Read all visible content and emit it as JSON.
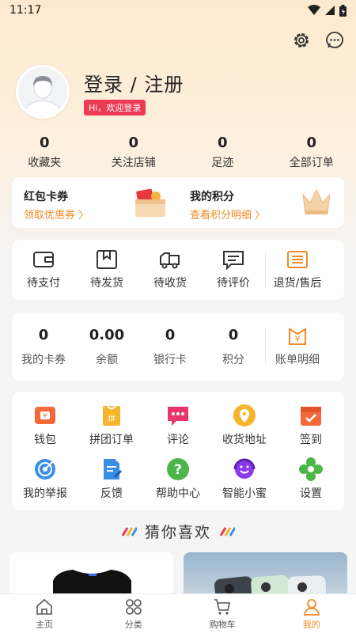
{
  "status_bar": {
    "time": "11:17"
  },
  "profile": {
    "login_text": "登录 / 注册",
    "greeting": "Hi，欢迎登录"
  },
  "stats": [
    {
      "value": "0",
      "label": "收藏夹"
    },
    {
      "value": "0",
      "label": "关注店铺"
    },
    {
      "value": "0",
      "label": "足迹"
    },
    {
      "value": "0",
      "label": "全部订单"
    }
  ],
  "promo": {
    "coupons": {
      "title": "红包卡券",
      "subtitle": "领取优惠券 〉"
    },
    "points": {
      "title": "我的积分",
      "subtitle": "查看积分明细 〉"
    }
  },
  "orders": [
    "待支付",
    "待发货",
    "待收货",
    "待评价",
    "退货/售后"
  ],
  "wallet": [
    {
      "value": "0",
      "label": "我的卡券"
    },
    {
      "value": "0.00",
      "label": "余额"
    },
    {
      "value": "0",
      "label": "银行卡"
    },
    {
      "value": "0",
      "label": "积分"
    }
  ],
  "wallet_detail": "账单明细",
  "services": [
    "钱包",
    "拼团订单",
    "评论",
    "收货地址",
    "签到",
    "我的举报",
    "反馈",
    "帮助中心",
    "智能小蜜",
    "设置"
  ],
  "recommend_title": "猜你喜欢",
  "tabs": [
    "主页",
    "分类",
    "购物车",
    "我的"
  ],
  "colors": {
    "accent": "#f08a24",
    "badge": "#ee3b53"
  }
}
